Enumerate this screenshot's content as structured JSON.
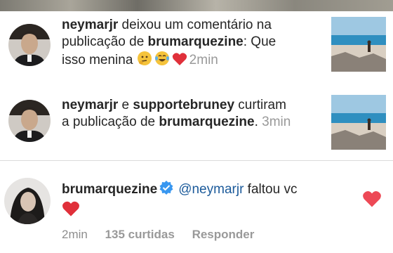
{
  "notifications": [
    {
      "user": "neymarjr",
      "text_before": " deixou um comentário na publicação de ",
      "target": "brumarquezine",
      "text_after": ": Que isso menina ",
      "emojis": [
        "thinking-face-icon",
        "tears-of-joy-icon",
        "red-heart-icon"
      ],
      "time": "2min"
    },
    {
      "user1": "neymarjr",
      "connector": " e ",
      "user2": "supportebruney",
      "text_mid": " curtiram a publicação de ",
      "target": "brumarquezine",
      "time": "3min"
    }
  ],
  "comment": {
    "username": "brumarquezine",
    "mention": "@neymarjr",
    "text": " faltou vc ",
    "time": "2min",
    "likes": "135 curtidas",
    "reply": "Responder"
  },
  "colors": {
    "text": "#262626",
    "time_gray": "#999999",
    "mention_blue": "#1b5a9a",
    "verified_blue": "#3897f0",
    "heart_red": "#ed4956"
  }
}
